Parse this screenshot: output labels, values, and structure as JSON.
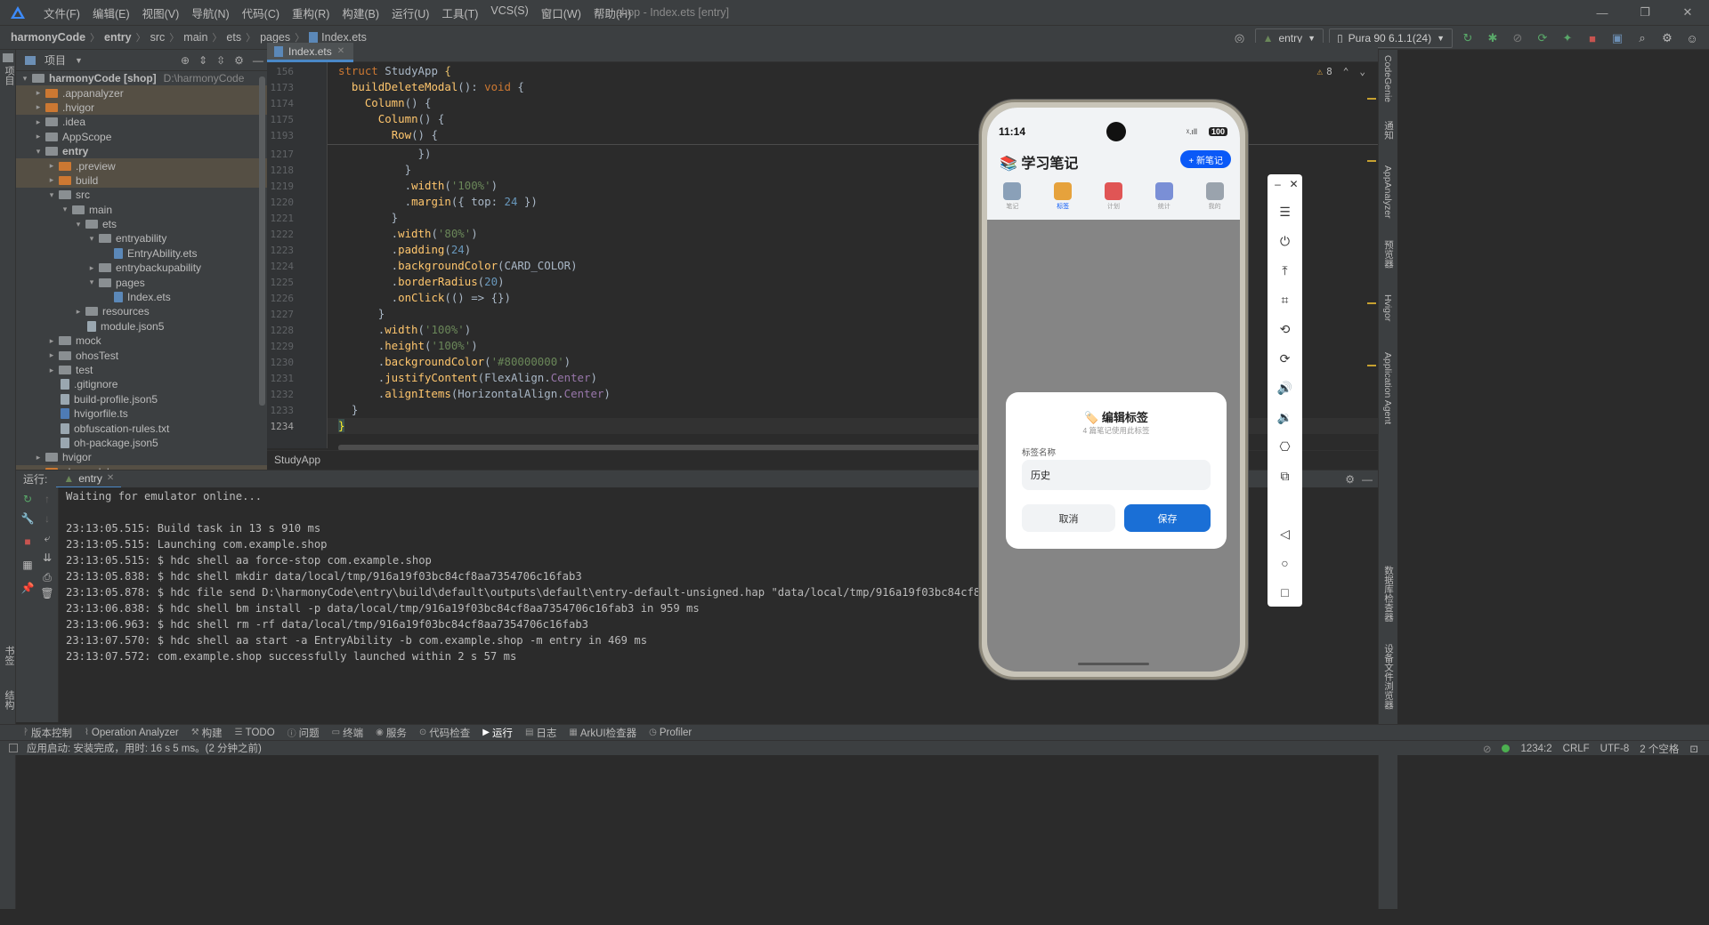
{
  "menu": {
    "items": [
      "文件(F)",
      "编辑(E)",
      "视图(V)",
      "导航(N)",
      "代码(C)",
      "重构(R)",
      "构建(B)",
      "运行(U)",
      "工具(T)",
      "VCS(S)",
      "窗口(W)",
      "帮助(H)"
    ],
    "window_title": "shop - Index.ets [entry]"
  },
  "breadcrumb": [
    "harmonyCode",
    "entry",
    "src",
    "main",
    "ets",
    "pages",
    "Index.ets"
  ],
  "toolbar": {
    "module_combo": "entry",
    "device_combo": "Pura 90 6.1.1(24)"
  },
  "project_panel": {
    "title": "项目",
    "tree": [
      {
        "label": "harmonyCode [shop]",
        "extra": "D:\\harmonyCode",
        "depth": 0,
        "arrow": "open",
        "icon": "fold gray"
      },
      {
        "label": ".appanalyzer",
        "depth": 1,
        "arrow": "closed",
        "icon": "fold orange",
        "hl": true
      },
      {
        "label": ".hvigor",
        "depth": 1,
        "arrow": "closed",
        "icon": "fold orange",
        "hl": true
      },
      {
        "label": ".idea",
        "depth": 1,
        "arrow": "closed",
        "icon": "fold gray"
      },
      {
        "label": "AppScope",
        "depth": 1,
        "arrow": "closed",
        "icon": "fold gray"
      },
      {
        "label": "entry",
        "depth": 1,
        "arrow": "open",
        "icon": "fold gray",
        "bold": true
      },
      {
        "label": ".preview",
        "depth": 2,
        "arrow": "closed",
        "icon": "fold orange",
        "hl": true
      },
      {
        "label": "build",
        "depth": 2,
        "arrow": "closed",
        "icon": "fold orange",
        "hl": true
      },
      {
        "label": "src",
        "depth": 2,
        "arrow": "open",
        "icon": "fold gray"
      },
      {
        "label": "main",
        "depth": 3,
        "arrow": "open",
        "icon": "fold gray"
      },
      {
        "label": "ets",
        "depth": 4,
        "arrow": "open",
        "icon": "fold gray"
      },
      {
        "label": "entryability",
        "depth": 5,
        "arrow": "open",
        "icon": "fold gray"
      },
      {
        "label": "EntryAbility.ets",
        "depth": 6,
        "arrow": "none",
        "icon": "file ets"
      },
      {
        "label": "entrybackupability",
        "depth": 5,
        "arrow": "closed",
        "icon": "fold gray"
      },
      {
        "label": "pages",
        "depth": 5,
        "arrow": "open",
        "icon": "fold gray"
      },
      {
        "label": "Index.ets",
        "depth": 6,
        "arrow": "none",
        "icon": "file ets"
      },
      {
        "label": "resources",
        "depth": 4,
        "arrow": "closed",
        "icon": "fold gray"
      },
      {
        "label": "module.json5",
        "depth": 4,
        "arrow": "none",
        "icon": "file"
      },
      {
        "label": "mock",
        "depth": 2,
        "arrow": "closed",
        "icon": "fold gray"
      },
      {
        "label": "ohosTest",
        "depth": 2,
        "arrow": "closed",
        "icon": "fold gray"
      },
      {
        "label": "test",
        "depth": 2,
        "arrow": "closed",
        "icon": "fold gray"
      },
      {
        "label": ".gitignore",
        "depth": 2,
        "arrow": "none",
        "icon": "file"
      },
      {
        "label": "build-profile.json5",
        "depth": 2,
        "arrow": "none",
        "icon": "file"
      },
      {
        "label": "hvigorfile.ts",
        "depth": 2,
        "arrow": "none",
        "icon": "file ts"
      },
      {
        "label": "obfuscation-rules.txt",
        "depth": 2,
        "arrow": "none",
        "icon": "file"
      },
      {
        "label": "oh-package.json5",
        "depth": 2,
        "arrow": "none",
        "icon": "file"
      },
      {
        "label": "hvigor",
        "depth": 1,
        "arrow": "closed",
        "icon": "fold gray"
      },
      {
        "label": "oh_modules",
        "depth": 1,
        "arrow": "closed",
        "icon": "fold orange",
        "hl": true
      }
    ]
  },
  "editor": {
    "tab": "Index.ets",
    "warnings": "8",
    "sticky_lines": [
      {
        "n": "156",
        "html": "<span class=\"kw\">struct</span> <span class=\"fn\" style=\"color:#a9b7c6\">StudyApp</span> <span style=\"color:#e8bf6a\">{</span>"
      },
      {
        "n": "1173",
        "html": "  <span class=\"fn\">buildDeleteModal</span>(): <span class=\"kw\">void</span> {"
      },
      {
        "n": "1174",
        "html": "    <span class=\"fn\">Column</span>() {"
      },
      {
        "n": "1175",
        "html": "      <span class=\"fn\">Column</span>() {"
      },
      {
        "n": "1193",
        "html": "        <span class=\"fn\">Row</span>() {"
      }
    ],
    "lines": [
      {
        "n": "1217",
        "html": "            })"
      },
      {
        "n": "1218",
        "html": "          }"
      },
      {
        "n": "1219",
        "html": "          .<span class=\"fn\">width</span>(<span class=\"str\">'100%'</span>)"
      },
      {
        "n": "1220",
        "html": "          .<span class=\"fn\">margin</span>({ <span class=\"dot\">top</span>: <span class=\"num\">24</span> })"
      },
      {
        "n": "1221",
        "html": "        }"
      },
      {
        "n": "1222",
        "html": "        .<span class=\"fn\">width</span>(<span class=\"str\">'80%'</span>)"
      },
      {
        "n": "1223",
        "html": "        .<span class=\"fn\">padding</span>(<span class=\"num\">24</span>)"
      },
      {
        "n": "1224",
        "html": "        .<span class=\"fn\">backgroundColor</span>(CARD_COLOR)"
      },
      {
        "n": "1225",
        "html": "        .<span class=\"fn\">borderRadius</span>(<span class=\"num\">20</span>)"
      },
      {
        "n": "1226",
        "html": "        .<span class=\"fn\">onClick</span>(() => {})"
      },
      {
        "n": "1227",
        "html": "      }"
      },
      {
        "n": "1228",
        "html": "      .<span class=\"fn\">width</span>(<span class=\"str\">'100%'</span>)"
      },
      {
        "n": "1229",
        "html": "      .<span class=\"fn\">height</span>(<span class=\"str\">'100%'</span>)"
      },
      {
        "n": "1230",
        "html": "      .<span class=\"fn\">backgroundColor</span>(<span class=\"str\">'#80000000'</span>)"
      },
      {
        "n": "1231",
        "html": "      .<span class=\"fn\">justifyContent</span>(FlexAlign.<span class=\"prop\">Center</span>)"
      },
      {
        "n": "1232",
        "html": "      .<span class=\"fn\">alignItems</span>(HorizontalAlign.<span class=\"prop\">Center</span>)"
      },
      {
        "n": "1233",
        "html": "  }"
      },
      {
        "n": "1234",
        "html": "<span style=\"background:#3b514d;color:#ffef28\">}</span>"
      }
    ],
    "code_breadcrumb": "StudyApp"
  },
  "run_panel": {
    "label": "运行:",
    "tab": "entry",
    "lines": [
      "Waiting for emulator online...",
      "",
      "23:13:05.515: Build task in 13 s 910 ms",
      "23:13:05.515: Launching com.example.shop",
      "23:13:05.515: $ hdc shell aa force-stop com.example.shop",
      "23:13:05.838: $ hdc shell mkdir data/local/tmp/916a19f03bc84cf8aa7354706c16fab3",
      "23:13:05.878: $ hdc file send D:\\harmonyCode\\entry\\build\\default\\outputs\\default\\entry-default-unsigned.hap \"data/local/tmp/916a19f03bc84cf8aa7354706c16fab3\"",
      "23:13:06.838: $ hdc shell bm install -p data/local/tmp/916a19f03bc84cf8aa7354706c16fab3 in 959 ms",
      "23:13:06.963: $ hdc shell rm -rf data/local/tmp/916a19f03bc84cf8aa7354706c16fab3",
      "23:13:07.570: $ hdc shell aa start -a EntryAbility -b com.example.shop -m entry in 469 ms",
      "23:13:07.572: com.example.shop successfully launched within 2 s 57 ms"
    ]
  },
  "left_strip": {
    "top": "项目",
    "bottom1": "书签",
    "bottom2": "结构"
  },
  "right_strip": [
    "CodeGenie",
    "通知",
    "AppAnalyzer",
    "预览器",
    "Hvigor",
    "Application Agent",
    "数据库检查器",
    "设备文件浏览器"
  ],
  "bottom_tabs": [
    {
      "label": "版本控制",
      "icon": "ᚹ"
    },
    {
      "label": "Operation Analyzer",
      "icon": "⌇"
    },
    {
      "label": "构建",
      "icon": "⚒"
    },
    {
      "label": "TODO",
      "icon": "☰"
    },
    {
      "label": "问题",
      "icon": "ⓘ"
    },
    {
      "label": "终端",
      "icon": "▭"
    },
    {
      "label": "服务",
      "icon": "◉"
    },
    {
      "label": "代码检查",
      "icon": "⊙"
    },
    {
      "label": "运行",
      "icon": "▶",
      "active": true
    },
    {
      "label": "日志",
      "icon": "▤"
    },
    {
      "label": "ArkUI检查器",
      "icon": "▦"
    },
    {
      "label": "Profiler",
      "icon": "◷"
    }
  ],
  "status": {
    "message": "应用启动: 安装完成，用时: 16 s 5 ms。(2 分钟之前)",
    "position": "1234:2",
    "line_sep": "CRLF",
    "encoding": "UTF-8",
    "indent": "2 个空格"
  },
  "phone": {
    "time": "11:14",
    "battery": "100",
    "app_title": "📚 学习笔记",
    "new_button": "+ 新笔记",
    "tabs": [
      {
        "label": "笔记",
        "color": "#8aa0b8"
      },
      {
        "label": "标签",
        "color": "#e6a23c",
        "active": true
      },
      {
        "label": "计划",
        "color": "#e05555"
      },
      {
        "label": "统计",
        "color": "#7a8fd6"
      },
      {
        "label": "我的",
        "color": "#9aa3ad"
      }
    ],
    "dialog": {
      "title": "🏷️ 编辑标签",
      "subtitle": "4 篇笔记使用此标签",
      "field_label": "标签名称",
      "field_value": "历史",
      "cancel": "取消",
      "save": "保存"
    }
  },
  "colors": {
    "accent": "#4a88c7",
    "phone_primary": "#0a59f7",
    "save_button": "#1a6fd6",
    "highlight_row": "#554f44"
  }
}
